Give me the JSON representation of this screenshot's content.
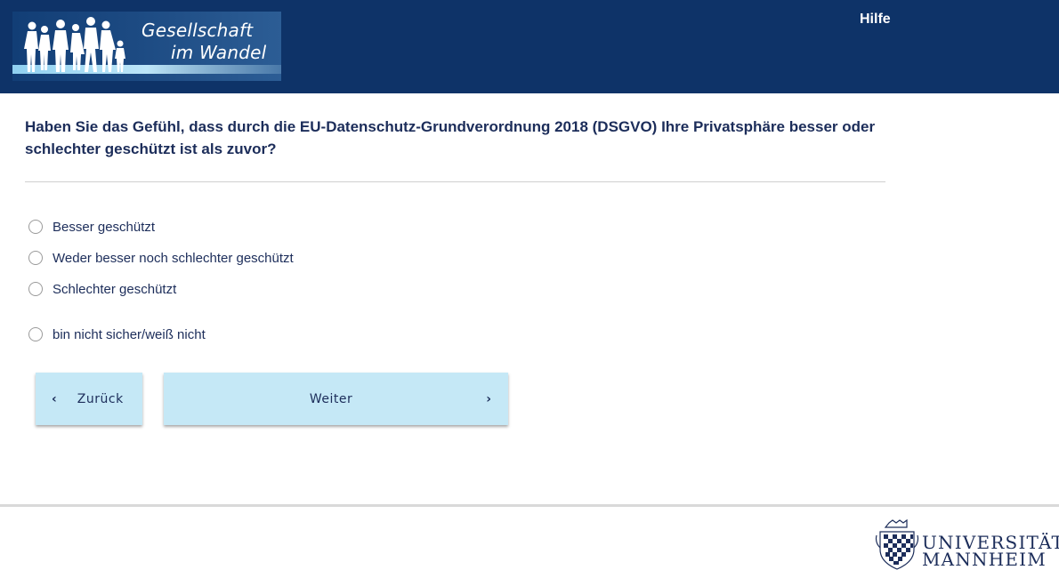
{
  "header": {
    "logo_line1": "Gesellschaft",
    "logo_line2": "im Wandel",
    "help_label": "Hilfe",
    "bg_color": "#0e3368"
  },
  "question": {
    "text": "Haben Sie das Gefühl, dass durch die EU-Datenschutz-Grundverordnung 2018 (DSGVO) Ihre Privatsphäre besser oder schlechter geschützt ist als zuvor?"
  },
  "options": [
    {
      "label": "Besser geschützt",
      "selected": false
    },
    {
      "label": "Weder besser noch schlechter geschützt",
      "selected": false
    },
    {
      "label": "Schlechter geschützt",
      "selected": false
    },
    {
      "label": "bin nicht sicher/weiß nicht",
      "selected": false
    }
  ],
  "nav": {
    "back_label": "Zurück",
    "back_icon": "chevron-left-icon",
    "next_label": "Weiter",
    "next_icon": "chevron-right-icon",
    "button_color": "#c5e8f6"
  },
  "footer": {
    "university_line1": "UNIVERSITÄT",
    "university_line2": "MANNHEIM"
  }
}
